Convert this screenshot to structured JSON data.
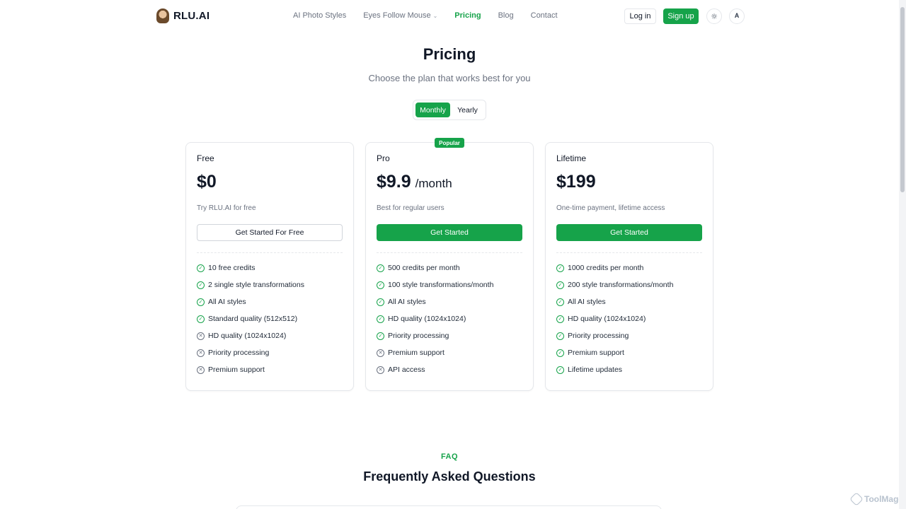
{
  "header": {
    "brand": "RLU.AI",
    "nav": [
      {
        "label": "AI Photo Styles",
        "dropdown": false,
        "active": false
      },
      {
        "label": "Eyes Follow Mouse",
        "dropdown": true,
        "active": false
      },
      {
        "label": "Pricing",
        "dropdown": false,
        "active": true
      },
      {
        "label": "Blog",
        "dropdown": false,
        "active": false
      },
      {
        "label": "Contact",
        "dropdown": false,
        "active": false
      }
    ],
    "login_label": "Log in",
    "signup_label": "Sign up",
    "theme_icon": "sun-icon",
    "language_icon": "translate-icon"
  },
  "hero": {
    "title": "Pricing",
    "subtitle": "Choose the plan that works best for you"
  },
  "billing_toggle": {
    "options": [
      "Monthly",
      "Yearly"
    ],
    "selected": "Monthly"
  },
  "plans": [
    {
      "name": "Free",
      "price": "$0",
      "period": "",
      "description": "Try RLU.AI for free",
      "cta": "Get Started For Free",
      "cta_style": "outline",
      "badge": "",
      "features": [
        {
          "text": "10 free credits",
          "included": true
        },
        {
          "text": "2 single style transformations",
          "included": true
        },
        {
          "text": "All AI styles",
          "included": true
        },
        {
          "text": "Standard quality (512x512)",
          "included": true
        },
        {
          "text": "HD quality (1024x1024)",
          "included": false
        },
        {
          "text": "Priority processing",
          "included": false
        },
        {
          "text": "Premium support",
          "included": false
        }
      ]
    },
    {
      "name": "Pro",
      "price": "$9.9",
      "period": "/month",
      "description": "Best for regular users",
      "cta": "Get Started",
      "cta_style": "filled",
      "badge": "Popular",
      "features": [
        {
          "text": "500 credits per month",
          "included": true
        },
        {
          "text": "100 style transformations/month",
          "included": true
        },
        {
          "text": "All AI styles",
          "included": true
        },
        {
          "text": "HD quality (1024x1024)",
          "included": true
        },
        {
          "text": "Priority processing",
          "included": true
        },
        {
          "text": "Premium support",
          "included": false
        },
        {
          "text": "API access",
          "included": false
        }
      ]
    },
    {
      "name": "Lifetime",
      "price": "$199",
      "period": "",
      "description": "One-time payment, lifetime access",
      "cta": "Get Started",
      "cta_style": "filled",
      "badge": "",
      "features": [
        {
          "text": "1000 credits per month",
          "included": true
        },
        {
          "text": "200 style transformations/month",
          "included": true
        },
        {
          "text": "All AI styles",
          "included": true
        },
        {
          "text": "HD quality (1024x1024)",
          "included": true
        },
        {
          "text": "Priority processing",
          "included": true
        },
        {
          "text": "Premium support",
          "included": true
        },
        {
          "text": "Lifetime updates",
          "included": true
        }
      ]
    }
  ],
  "faq": {
    "kicker": "FAQ",
    "title": "Frequently Asked Questions"
  },
  "watermark": "ToolMage",
  "colors": {
    "accent": "#16a34a",
    "text": "#111827",
    "muted": "#6b7280",
    "border": "#e5e7eb"
  }
}
